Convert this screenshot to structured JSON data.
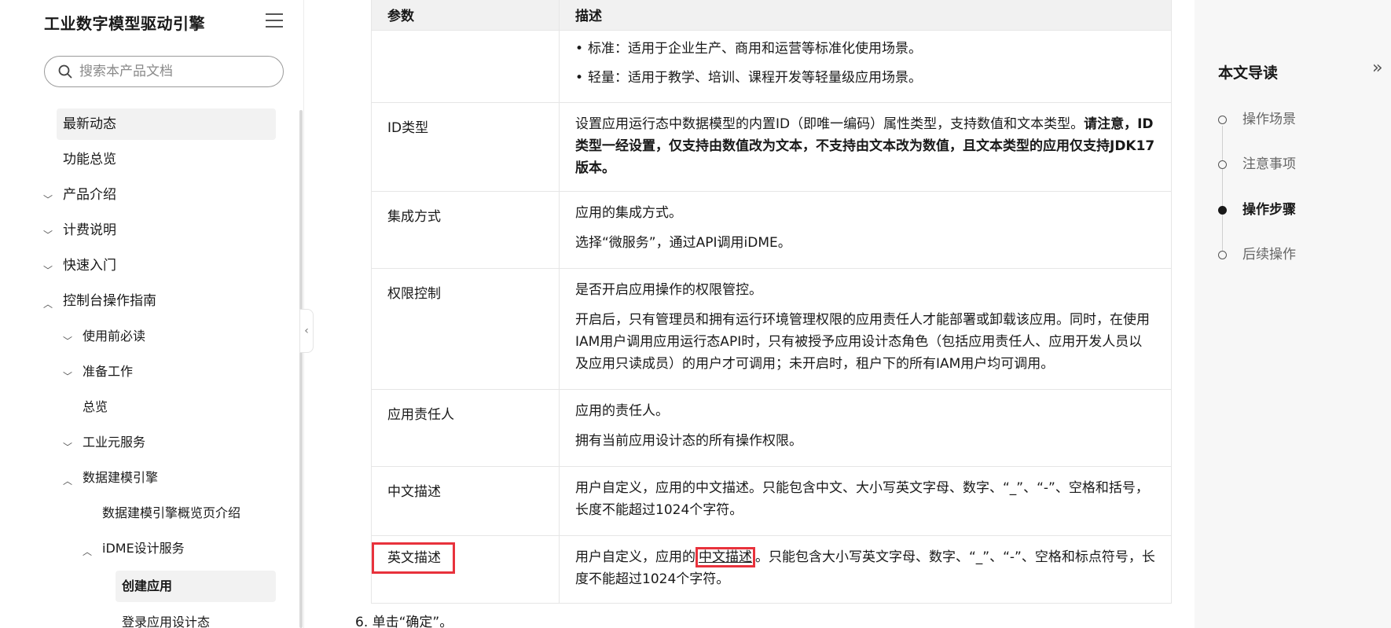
{
  "sidebar": {
    "title": "工业数字模型驱动引擎",
    "search_placeholder": "搜索本产品文档",
    "items": [
      {
        "label": "最新动态"
      },
      {
        "label": "功能总览"
      },
      {
        "label": "产品介绍"
      },
      {
        "label": "计费说明"
      },
      {
        "label": "快速入门"
      },
      {
        "label": "控制台操作指南"
      },
      {
        "label": "使用前必读"
      },
      {
        "label": "准备工作"
      },
      {
        "label": "总览"
      },
      {
        "label": "工业元服务"
      },
      {
        "label": "数据建模引擎"
      },
      {
        "label": "数据建模引擎概览页介绍"
      },
      {
        "label": "iDME设计服务"
      },
      {
        "label": "创建应用"
      },
      {
        "label": "登录应用设计态"
      }
    ]
  },
  "table": {
    "headers": [
      "参数",
      "描述"
    ],
    "rows": [
      {
        "param": "",
        "lines": [
          "标准：适用于企业生产、商用和运营等标准化使用场景。",
          "轻量：适用于教学、培训、课程开发等轻量级应用场景。"
        ]
      },
      {
        "param": "ID类型",
        "text": "设置应用运行态中数据模型的内置ID（即唯一编码）属性类型，支持数值和文本类型。",
        "bold": "请注意，ID类型一经设置，仅支持由数值改为文本，不支持由文本改为数值，且文本类型的应用仅支持JDK17版本。"
      },
      {
        "param": "集成方式",
        "p1": "应用的集成方式。",
        "p2": "选择“微服务”，通过API调用iDME。"
      },
      {
        "param": "权限控制",
        "p1": "是否开启应用操作的权限管控。",
        "p2": "开启后，只有管理员和拥有运行环境管理权限的应用责任人才能部署或卸载该应用。同时，在使用IAM用户调用应用运行态API时，只有被授予应用设计态角色（包括应用责任人、应用开发人员以及应用只读成员）的用户才可调用；未开启时，租户下的所有IAM用户均可调用。"
      },
      {
        "param": "应用责任人",
        "p1": "应用的责任人。",
        "p2": "拥有当前应用设计态的所有操作权限。"
      },
      {
        "param": "中文描述",
        "p1": "用户自定义，应用的中文描述。只能包含中文、大小写英文字母、数字、“_”、“-”、空格和括号，长度不能超过1024个字符。"
      },
      {
        "param": "英文描述",
        "pre": "用户自定义，应用的",
        "mark": "中文描述",
        "post": "。只能包含大小写英文字母、数字、“_”、“-”、空格和标点符号，长度不能超过1024个字符。"
      }
    ]
  },
  "step": "6. 单击“确定”。",
  "toc": {
    "title": "本文导读",
    "items": [
      {
        "label": "操作场景"
      },
      {
        "label": "注意事项"
      },
      {
        "label": "操作步骤"
      },
      {
        "label": "后续操作"
      }
    ]
  },
  "colors": {
    "highlight_box": "#e8323c",
    "active_bg": "#f2f2f2",
    "toc_bg": "#f7f7f7"
  }
}
